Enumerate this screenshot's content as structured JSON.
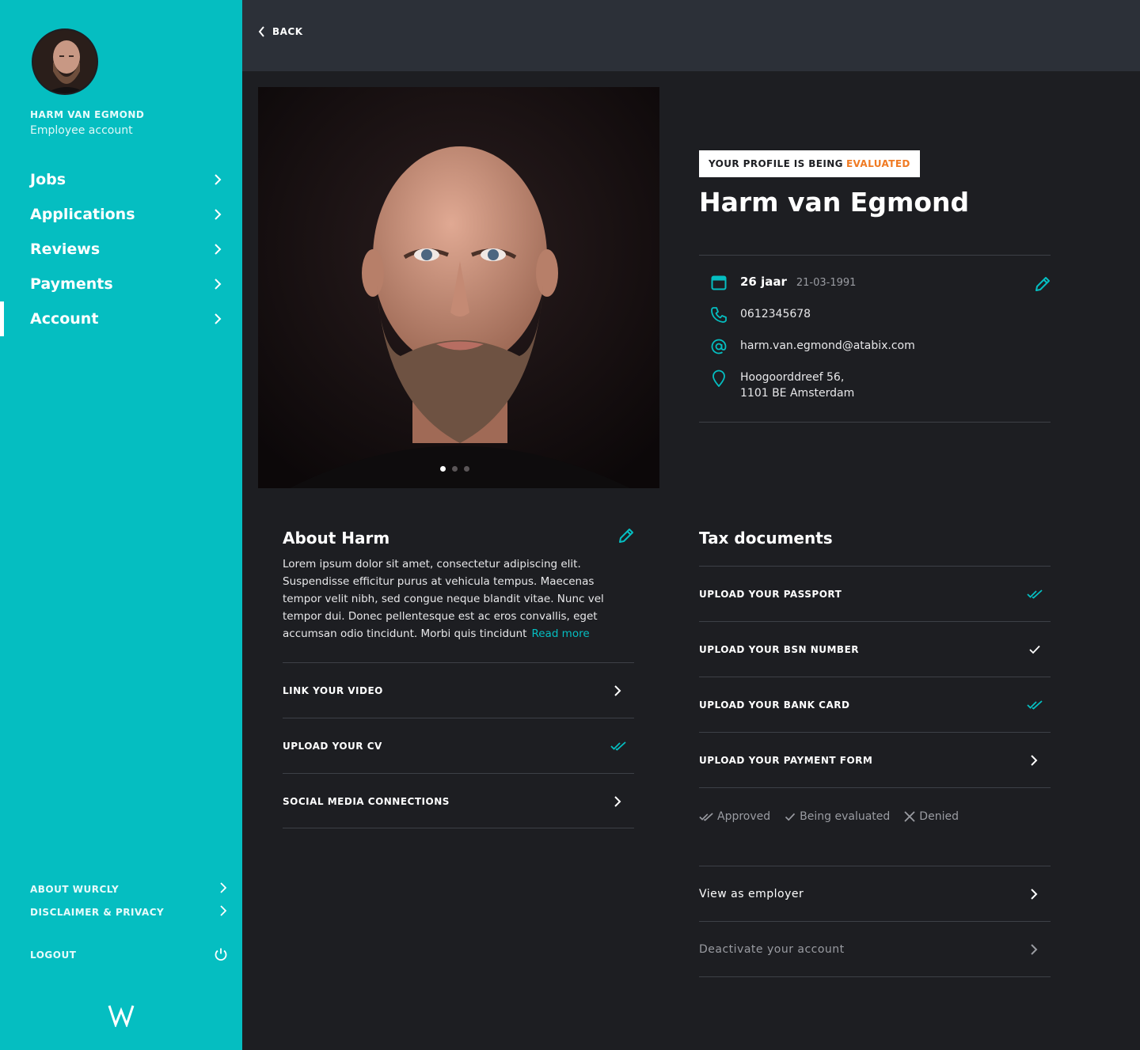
{
  "sidebar": {
    "user_name": "HARM VAN EGMOND",
    "user_role": "Employee account",
    "nav": [
      {
        "label": "Jobs",
        "active": false
      },
      {
        "label": "Applications",
        "active": false
      },
      {
        "label": "Reviews",
        "active": false
      },
      {
        "label": "Payments",
        "active": false
      },
      {
        "label": "Account",
        "active": true
      }
    ],
    "footer": {
      "about": "ABOUT WURCLY",
      "disclaimer": "DISCLAIMER & PRIVACY",
      "logout": "LOGOUT"
    }
  },
  "topbar": {
    "back_label": "BACK"
  },
  "profile": {
    "status_prefix": "YOUR PROFILE IS BEING",
    "status_highlight": "EVALUATED",
    "name": "Harm van Egmond",
    "age": "26 jaar",
    "dob": "21-03-1991",
    "phone": "0612345678",
    "email": "harm.van.egmond@atabix.com",
    "address_line1": "Hoogoorddreef 56,",
    "address_line2": "1101 BE Amsterdam"
  },
  "about": {
    "title": "About Harm",
    "text": "Lorem ipsum dolor sit amet, consectetur adipiscing elit. Suspendisse efficitur purus at vehicula tempus. Maecenas tempor velit nibh, sed congue neque blandit vitae. Nunc vel tempor dui. Donec pellentesque est ac eros convallis, eget accumsan odio tincidunt. Morbi quis tincidunt",
    "read_more": "Read more",
    "rows": [
      {
        "label": "LINK YOUR VIDEO",
        "status": "arrow"
      },
      {
        "label": "UPLOAD YOUR CV",
        "status": "approved"
      },
      {
        "label": "SOCIAL MEDIA CONNECTIONS",
        "status": "arrow"
      }
    ]
  },
  "tax": {
    "title": "Tax documents",
    "rows": [
      {
        "label": "UPLOAD YOUR PASSPORT",
        "status": "approved"
      },
      {
        "label": "UPLOAD YOUR BSN NUMBER",
        "status": "evaluating"
      },
      {
        "label": "UPLOAD YOUR BANK CARD",
        "status": "approved"
      },
      {
        "label": "UPLOAD YOUR PAYMENT FORM",
        "status": "arrow"
      }
    ],
    "legend": {
      "approved": "Approved",
      "evaluating": "Being evaluated",
      "denied": "Denied"
    },
    "view_as_employer": "View as employer",
    "deactivate": "Deactivate your account"
  },
  "colors": {
    "accent": "#05bec1",
    "highlight": "#f07a22",
    "background": "#1d1e22",
    "topbar": "#2c3038"
  },
  "photo_carousel": {
    "slides": 3,
    "active": 1
  }
}
